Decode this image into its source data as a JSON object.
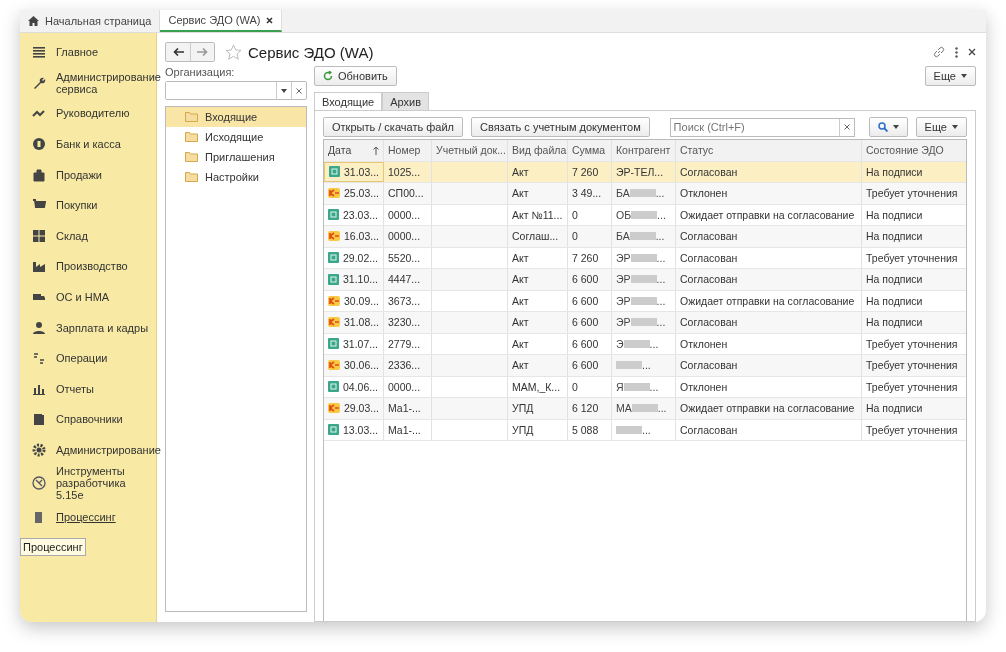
{
  "top_tabs": [
    {
      "label": "Начальная страница",
      "kind": "home",
      "selected": false
    },
    {
      "label": "Сервис ЭДО (WA)",
      "kind": "doc",
      "selected": true
    }
  ],
  "sidebar": {
    "items": [
      {
        "label": "Главное",
        "kind": "menu",
        "underlined": false
      },
      {
        "label": "Администрирование сервиса",
        "kind": "wrench",
        "underlined": false
      },
      {
        "label": "Руководителю",
        "kind": "trend",
        "underlined": false
      },
      {
        "label": "Банк и касса",
        "kind": "coin",
        "underlined": false
      },
      {
        "label": "Продажи",
        "kind": "bag",
        "underlined": false
      },
      {
        "label": "Покупки",
        "kind": "cart",
        "underlined": false
      },
      {
        "label": "Склад",
        "kind": "grid",
        "underlined": false
      },
      {
        "label": "Производство",
        "kind": "factory",
        "underlined": false
      },
      {
        "label": "ОС и НМА",
        "kind": "truck",
        "underlined": false
      },
      {
        "label": "Зарплата и кадры",
        "kind": "person",
        "underlined": false
      },
      {
        "label": "Операции",
        "kind": "dtkt",
        "underlined": false
      },
      {
        "label": "Отчеты",
        "kind": "bars",
        "underlined": false
      },
      {
        "label": "Справочники",
        "kind": "books",
        "underlined": false
      },
      {
        "label": "Администрирование",
        "kind": "gear",
        "underlined": false
      },
      {
        "label": "Инструменты разработчика 5.15e",
        "kind": "tools",
        "underlined": false
      },
      {
        "label": "Процессинг",
        "kind": "page",
        "underlined": true
      }
    ],
    "tooltip": "Процессинг"
  },
  "form": {
    "title": "Сервис ЭДО (WA)",
    "organization_label": "Организация:",
    "tree": [
      {
        "label": "Входящие",
        "selected": true
      },
      {
        "label": "Исходящие",
        "selected": false
      },
      {
        "label": "Приглашения",
        "selected": false
      },
      {
        "label": "Настройки",
        "selected": false
      }
    ],
    "refresh_button": "Обновить",
    "more_button": "Еще",
    "tabs": [
      {
        "label": "Входящие",
        "selected": true
      },
      {
        "label": "Архив",
        "selected": false
      }
    ],
    "toolbar": {
      "open_button": "Открыть / скачать файл",
      "link_button": "Связать с учетным документом",
      "search": {
        "placeholder": "Поиск (Ctrl+F)"
      },
      "more_button": "Еще"
    }
  },
  "table": {
    "columns": [
      {
        "label": "Дата",
        "sorted": true
      },
      {
        "label": "Номер",
        "sorted": false
      },
      {
        "label": "Учетный док...",
        "sorted": false
      },
      {
        "label": "Вид файла",
        "sorted": false
      },
      {
        "label": "Сумма",
        "sorted": false
      },
      {
        "label": "Контрагент",
        "sorted": false
      },
      {
        "label": "Статус",
        "sorted": false
      },
      {
        "label": "Состояние ЭДО",
        "sorted": false
      }
    ],
    "rows": [
      {
        "kind": "d",
        "selected": true,
        "date": "31.03...",
        "number": "1025...",
        "file_type": "Акт",
        "sum": "7 260",
        "counterparty": {
          "prefix": "ЭР-ТЕЛ",
          "redacted": false,
          "suffix": "..."
        },
        "status": "Согласован",
        "edo_state": "На подписи"
      },
      {
        "kind": "k",
        "selected": false,
        "date": "25.03...",
        "number": "СП00...",
        "file_type": "Акт",
        "sum": "3 49...",
        "counterparty": {
          "prefix": "БА",
          "redacted": true,
          "suffix": "..."
        },
        "status": "Отклонен",
        "edo_state": "Требует уточнения"
      },
      {
        "kind": "d",
        "selected": false,
        "date": "23.03...",
        "number": "0000...",
        "file_type": "Акт №11...",
        "sum": "0",
        "counterparty": {
          "prefix": "ОБ",
          "redacted": true,
          "suffix": "..."
        },
        "status": "Ожидает отправки на согласование",
        "edo_state": "На подписи"
      },
      {
        "kind": "k",
        "selected": false,
        "date": "16.03...",
        "number": "0000...",
        "file_type": "Соглаш...",
        "sum": "0",
        "counterparty": {
          "prefix": "БА",
          "redacted": true,
          "suffix": "..."
        },
        "status": "Согласован",
        "edo_state": "На подписи"
      },
      {
        "kind": "d",
        "selected": false,
        "date": "29.02...",
        "number": "5520...",
        "file_type": "Акт",
        "sum": "7 260",
        "counterparty": {
          "prefix": "ЭР",
          "redacted": true,
          "suffix": "..."
        },
        "status": "Согласован",
        "edo_state": "Требует уточнения"
      },
      {
        "kind": "d",
        "selected": false,
        "date": "31.10...",
        "number": "4447...",
        "file_type": "Акт",
        "sum": "6 600",
        "counterparty": {
          "prefix": "ЭР",
          "redacted": true,
          "suffix": "..."
        },
        "status": "Согласован",
        "edo_state": "На подписи"
      },
      {
        "kind": "k",
        "selected": false,
        "date": "30.09...",
        "number": "3673...",
        "file_type": "Акт",
        "sum": "6 600",
        "counterparty": {
          "prefix": "ЭР",
          "redacted": true,
          "suffix": "..."
        },
        "status": "Ожидает отправки на согласование",
        "edo_state": "На подписи"
      },
      {
        "kind": "k",
        "selected": false,
        "date": "31.08...",
        "number": "3230...",
        "file_type": "Акт",
        "sum": "6 600",
        "counterparty": {
          "prefix": "ЭР",
          "redacted": true,
          "suffix": "..."
        },
        "status": "Согласован",
        "edo_state": "На подписи"
      },
      {
        "kind": "d",
        "selected": false,
        "date": "31.07...",
        "number": "2779...",
        "file_type": "Акт",
        "sum": "6 600",
        "counterparty": {
          "prefix": "Э",
          "redacted": true,
          "suffix": "..."
        },
        "status": "Отклонен",
        "edo_state": "Требует уточнения"
      },
      {
        "kind": "k",
        "selected": false,
        "date": "30.06...",
        "number": "2336...",
        "file_type": "Акт",
        "sum": "6 600",
        "counterparty": {
          "redacted": true,
          "suffix": "..."
        },
        "status": "Согласован",
        "edo_state": "Требует уточнения"
      },
      {
        "kind": "d",
        "selected": false,
        "date": "04.06...",
        "number": "0000...",
        "file_type": "МАМ,_К...",
        "sum": "0",
        "counterparty": {
          "prefix": "Я",
          "redacted": true,
          "suffix": "..."
        },
        "status": "Отклонен",
        "edo_state": "Требует уточнения"
      },
      {
        "kind": "k",
        "selected": false,
        "date": "29.03...",
        "number": "Ма1-...",
        "file_type": "УПД",
        "sum": "6 120",
        "counterparty": {
          "prefix": "МА",
          "redacted": true,
          "suffix": "..."
        },
        "status": "Ожидает отправки на согласование",
        "edo_state": "На подписи"
      },
      {
        "kind": "d",
        "selected": false,
        "date": "13.03...",
        "number": "Ма1-...",
        "file_type": "УПД",
        "sum": "5 088",
        "counterparty": {
          "redacted": true,
          "suffix": "..."
        },
        "status": "Согласован",
        "edo_state": "Требует уточнения"
      }
    ]
  }
}
